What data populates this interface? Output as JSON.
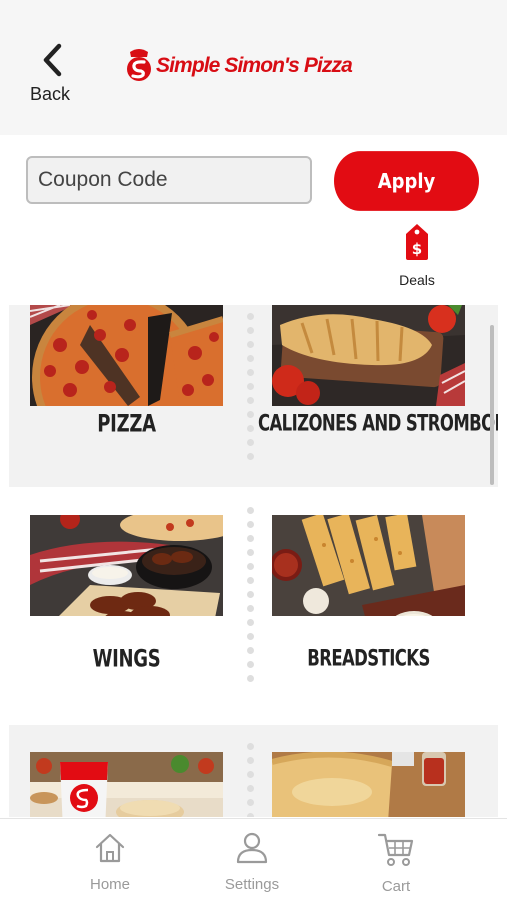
{
  "header": {
    "back_label": "Back",
    "brand": "Simple Simon's Pizza"
  },
  "coupon": {
    "placeholder": "Coupon Code",
    "value": "",
    "apply_label": "Apply"
  },
  "deals": {
    "label": "Deals",
    "icon": "price-tag-icon"
  },
  "categories": [
    {
      "label": "PIZZA"
    },
    {
      "label": "CALIZONES AND STROMBOLI"
    },
    {
      "label": "WINGS"
    },
    {
      "label": "BREADSTICKS"
    }
  ],
  "tabbar": {
    "home": "Home",
    "settings": "Settings",
    "cart": "Cart"
  },
  "colors": {
    "brand_red": "#e20c13",
    "tab_gray": "#9a9a9a",
    "band_gray": "#f2f2f2"
  }
}
